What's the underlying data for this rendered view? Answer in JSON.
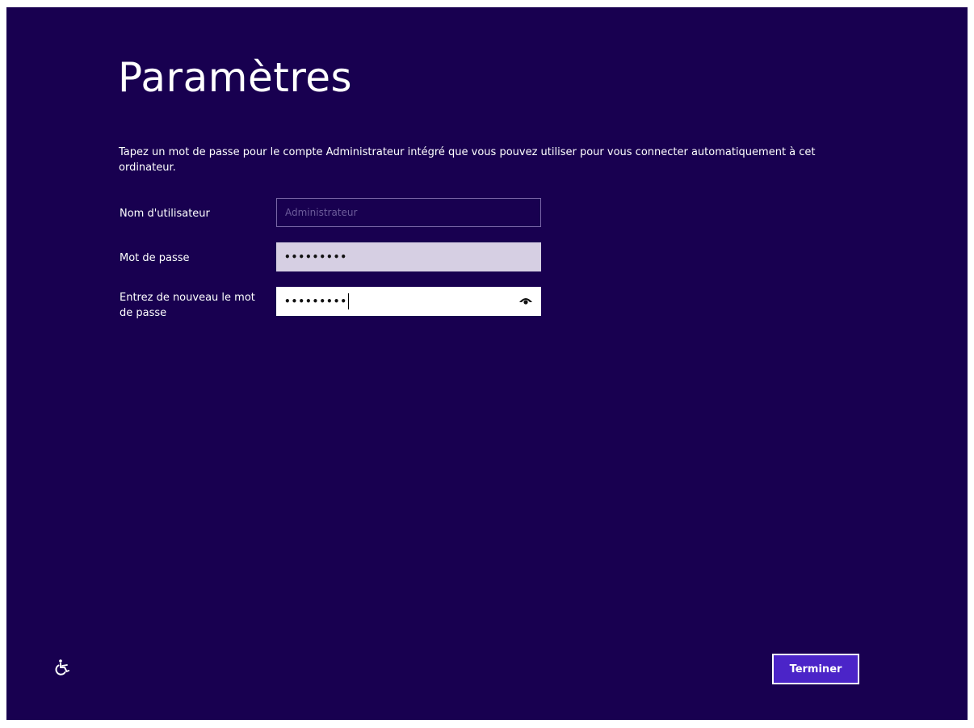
{
  "page": {
    "title": "Paramètres",
    "intro": "Tapez un mot de passe pour le compte Administrateur intégré que vous pouvez utiliser pour vous connecter automatiquement à cet ordinateur."
  },
  "form": {
    "username": {
      "label": "Nom d'utilisateur",
      "value": "Administrateur"
    },
    "password": {
      "label": "Mot de passe",
      "value": "•••••••••"
    },
    "confirm": {
      "label": "Entrez de nouveau le mot de passe",
      "value": "•••••••••"
    }
  },
  "footer": {
    "finish_label": "Terminer",
    "ease_icon": "ease-of-access-icon"
  },
  "colors": {
    "background": "#180050",
    "button": "#4b24c8",
    "password_field": "#d6cfe3",
    "username_border": "#7a66a8"
  }
}
